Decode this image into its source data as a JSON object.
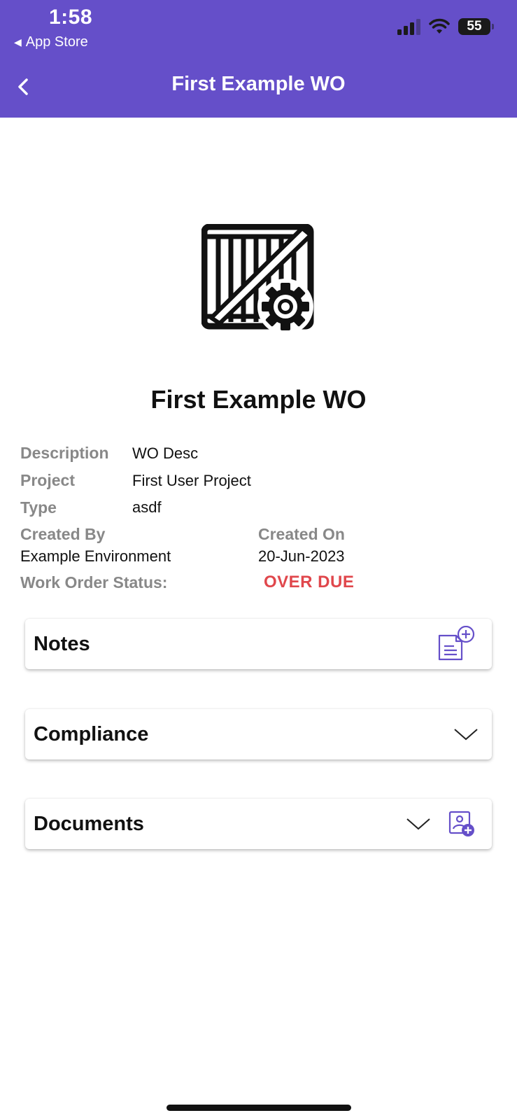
{
  "status_bar": {
    "time": "1:58",
    "back_app_label": "App Store",
    "battery": "55"
  },
  "nav": {
    "title": "First Example WO"
  },
  "work_order": {
    "title": "First Example WO",
    "description_label": "Description",
    "description_value": "WO Desc",
    "project_label": "Project",
    "project_value": "First User Project",
    "type_label": "Type",
    "type_value": "asdf",
    "created_by_label": "Created By",
    "created_by_value": "Example Environment",
    "created_on_label": "Created On",
    "created_on_value": "20-Jun-2023",
    "status_label": "Work Order Status:",
    "status_value": "OVER DUE"
  },
  "sections": {
    "notes": "Notes",
    "compliance": "Compliance",
    "documents": "Documents"
  },
  "colors": {
    "header_bg": "#654fc9",
    "accent": "#654fc9",
    "overdue": "#e0474c",
    "label_gray": "#888888"
  },
  "icons": {
    "hero": "crate-gear-icon",
    "back": "chevron-left-icon",
    "notes_add": "note-add-icon",
    "compliance_expand": "chevron-down-icon",
    "documents_expand": "chevron-down-icon",
    "documents_add": "image-add-icon"
  }
}
